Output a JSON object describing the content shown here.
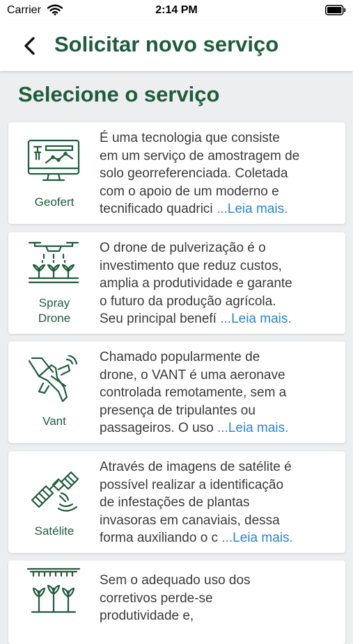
{
  "status": {
    "carrier": "Carrier",
    "time": "2:14 PM"
  },
  "header": {
    "title": "Solicitar novo serviço"
  },
  "section": {
    "title": "Selecione o serviço"
  },
  "services": [
    {
      "name": "Geofert",
      "icon": "monitor-chart-icon",
      "lines": [
        "É uma tecnologia que consiste",
        "em um serviço de amostragem de",
        "solo georreferenciada. Coletada",
        "com o apoio de um moderno e",
        "tecnificado quadrici "
      ],
      "read_more": "...Leia mais."
    },
    {
      "name": "Spray Drone",
      "label_lines": [
        "Spray",
        "Drone"
      ],
      "icon": "drone-spraying-icon",
      "lines": [
        "O drone de pulverização é o",
        "investimento que reduz custos,",
        "amplia a produtividade e garante",
        "o futuro da produção agrícola.",
        "Seu principal benefí "
      ],
      "read_more": "...Leia mais."
    },
    {
      "name": "Vant",
      "icon": "airplane-icon",
      "lines": [
        "Chamado popularmente de",
        "drone, o VANT é uma aeronave",
        "controlada remotamente, sem a",
        "presença de tripulantes ou",
        "passageiros. O uso  "
      ],
      "read_more": "...Leia mais."
    },
    {
      "name": "Satélite",
      "icon": "satellite-icon",
      "lines": [
        "Através de imagens de satélite é",
        "possível realizar a identificação",
        "de infestações de plantas",
        "invasoras em canaviais, dessa",
        "forma auxiliando o c "
      ],
      "read_more": "...Leia mais."
    },
    {
      "name": "",
      "icon": "greenhouse-plants-icon",
      "lines": [
        "Sem o adequado uso dos",
        "corretivos perde-se",
        "produtividade e,"
      ],
      "read_more": ""
    }
  ]
}
